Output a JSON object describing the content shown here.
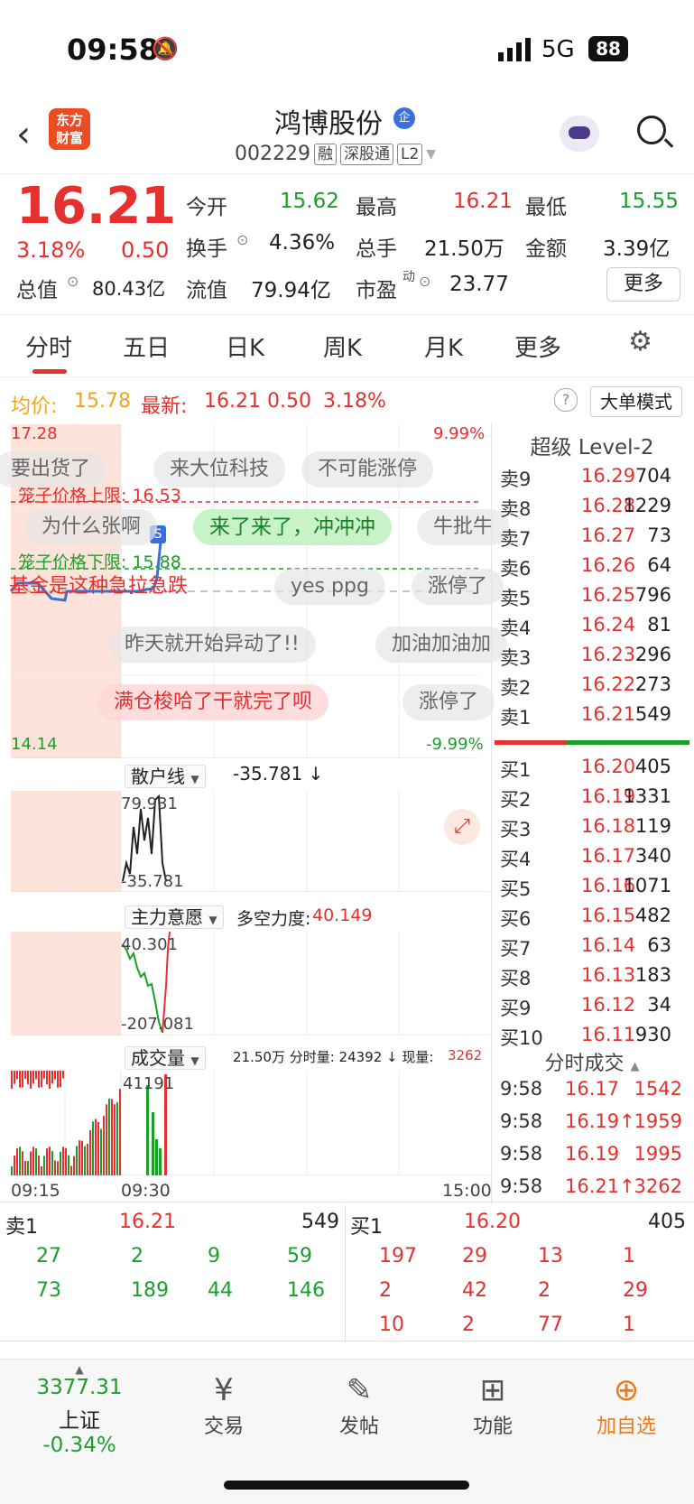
{
  "status": {
    "time": "09:58",
    "network": "5G",
    "battery": "88"
  },
  "header": {
    "logo_text": "东方\n财富",
    "stock_name": "鸿博股份",
    "badge": "企",
    "code": "002229",
    "tags": [
      "融",
      "深股通",
      "L2"
    ]
  },
  "quote": {
    "price": "16.21",
    "change_pct": "3.18%",
    "change": "0.50",
    "labels": {
      "open": "今开",
      "high": "最高",
      "low": "最低",
      "turnover": "换手",
      "volume": "总手",
      "amount": "金额",
      "mkt_cap": "总值",
      "float_cap": "流值",
      "pe": "市盈",
      "pe_sup": "动"
    },
    "values": {
      "open": "15.62",
      "high": "16.21",
      "low": "15.55",
      "turnover": "4.36%",
      "volume": "21.50万",
      "amount": "3.39亿",
      "mkt_cap": "80.43亿",
      "float_cap": "79.94亿",
      "pe": "23.77"
    },
    "more": "更多"
  },
  "tabs": [
    "分时",
    "五日",
    "日K",
    "周K",
    "月K",
    "更多"
  ],
  "avgbar": {
    "avg_label": "均价:",
    "avg": "15.78",
    "latest_label": "最新:",
    "latest": "16.21",
    "chg": "0.50",
    "pct": "3.18%",
    "mode": "大单模式"
  },
  "chart": {
    "ymax": "17.28",
    "ymin": "14.14",
    "pmax": "9.99%",
    "pmin": "-9.99%",
    "upper_limit": "笼子价格上限: 16.53",
    "lower_limit": "笼子价格下限: 15.88",
    "danmu": [
      "要出货了",
      "来大位科技",
      "不可能涨停",
      "为什么张啊",
      "来了来了，冲冲冲",
      "牛批牛",
      "基金是这种急拉急跌",
      "yes   ppg",
      "涨停了",
      "昨天就开始异动了!!",
      "加油加油加",
      "满仓梭哈了干就完了呗",
      "涨停了"
    ],
    "retail": {
      "label": "散户线",
      "value": "-35.781 ↓",
      "max": "79.931",
      "min": "-35.781"
    },
    "main": {
      "label": "主力意愿",
      "force_label": "多空力度:",
      "force": "40.149",
      "max": "40.301",
      "min": "-207.081"
    },
    "volume": {
      "label": "成交量",
      "info": "21.50万 分时量: 24392 ↓ 现量:",
      "now": "3262",
      "max": "41191"
    },
    "times": [
      "09:15",
      "09:30",
      "15:00"
    ]
  },
  "level2": {
    "title": "超级 Level-2",
    "asks": [
      {
        "l": "卖9",
        "p": "16.29",
        "v": "704"
      },
      {
        "l": "卖8",
        "p": "16.28",
        "v": "1229"
      },
      {
        "l": "卖7",
        "p": "16.27",
        "v": "73"
      },
      {
        "l": "卖6",
        "p": "16.26",
        "v": "64"
      },
      {
        "l": "卖5",
        "p": "16.25",
        "v": "796"
      },
      {
        "l": "卖4",
        "p": "16.24",
        "v": "81"
      },
      {
        "l": "卖3",
        "p": "16.23",
        "v": "296"
      },
      {
        "l": "卖2",
        "p": "16.22",
        "v": "273"
      },
      {
        "l": "卖1",
        "p": "16.21",
        "v": "549"
      }
    ],
    "bids": [
      {
        "l": "买1",
        "p": "16.20",
        "v": "405"
      },
      {
        "l": "买2",
        "p": "16.19",
        "v": "1331"
      },
      {
        "l": "买3",
        "p": "16.18",
        "v": "119"
      },
      {
        "l": "买4",
        "p": "16.17",
        "v": "340"
      },
      {
        "l": "买5",
        "p": "16.16",
        "v": "1071"
      },
      {
        "l": "买6",
        "p": "16.15",
        "v": "482"
      },
      {
        "l": "买7",
        "p": "16.14",
        "v": "63"
      },
      {
        "l": "买8",
        "p": "16.13",
        "v": "183"
      },
      {
        "l": "买9",
        "p": "16.12",
        "v": "34"
      },
      {
        "l": "买10",
        "p": "16.11",
        "v": "930"
      }
    ],
    "ticks_title": "分时成交",
    "ticks": [
      {
        "t": "9:58",
        "p": "16.17",
        "v": "1542"
      },
      {
        "t": "9:58",
        "p": "16.19↑",
        "v": "1959"
      },
      {
        "t": "9:58",
        "p": "16.19",
        "v": "1995"
      },
      {
        "t": "9:58",
        "p": "16.21↑",
        "v": "3262"
      }
    ]
  },
  "queue": {
    "ask_label": "卖1",
    "ask_price": "16.21",
    "ask_vol": "549",
    "bid_label": "买1",
    "bid_price": "16.20",
    "bid_vol": "405",
    "ask_rows": [
      [
        "27",
        "2",
        "9",
        "59"
      ],
      [
        "73",
        "189",
        "44",
        "146"
      ]
    ],
    "bid_rows": [
      [
        "197",
        "29",
        "13",
        "1"
      ],
      [
        "2",
        "42",
        "2",
        "29"
      ],
      [
        "10",
        "2",
        "77",
        "1"
      ]
    ]
  },
  "nav": {
    "index_value": "3377.31",
    "index_name": "上证",
    "index_chg": "-0.34%",
    "items": [
      "交易",
      "发帖",
      "功能",
      "加自选"
    ]
  }
}
